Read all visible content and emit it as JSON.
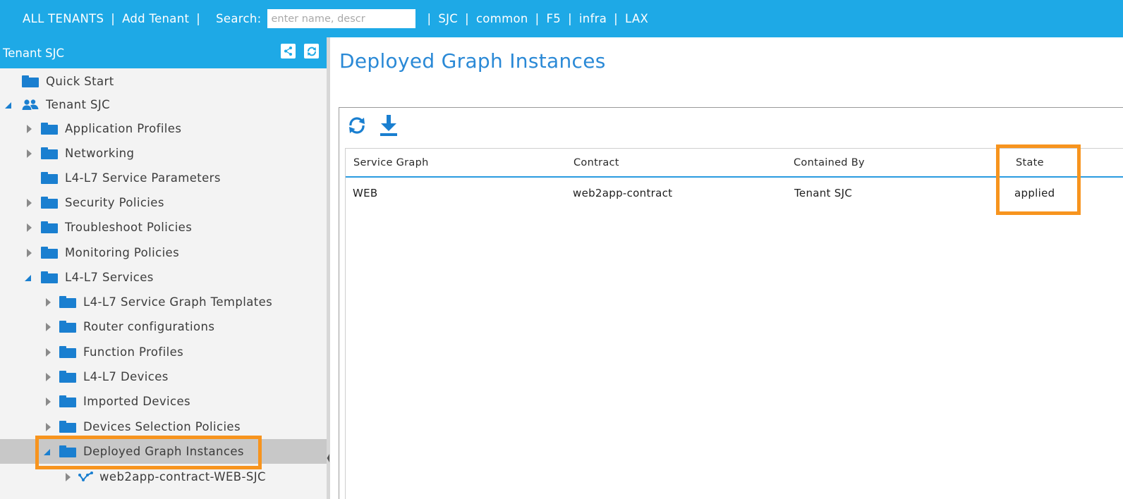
{
  "topbar": {
    "all_tenants": "ALL TENANTS",
    "add_tenant": "Add Tenant",
    "search_label": "Search:",
    "search_placeholder": "enter name, descr",
    "tenant_links": [
      "SJC",
      "common",
      "F5",
      "infra",
      "LAX"
    ]
  },
  "sidebar": {
    "title": "Tenant SJC",
    "tree": [
      {
        "label": "Quick Start",
        "level": 0,
        "toggle": "none",
        "icon": "folder-icon"
      },
      {
        "label": "Tenant SJC",
        "level": 0,
        "toggle": "expanded",
        "icon": "tenant-users-icon"
      },
      {
        "label": "Application Profiles",
        "level": 1,
        "toggle": "collapsed",
        "icon": "folder-icon"
      },
      {
        "label": "Networking",
        "level": 1,
        "toggle": "collapsed",
        "icon": "folder-icon"
      },
      {
        "label": "L4-L7 Service Parameters",
        "level": 1,
        "toggle": "none",
        "icon": "folder-icon"
      },
      {
        "label": "Security Policies",
        "level": 1,
        "toggle": "collapsed",
        "icon": "folder-icon"
      },
      {
        "label": "Troubleshoot Policies",
        "level": 1,
        "toggle": "collapsed",
        "icon": "folder-icon"
      },
      {
        "label": "Monitoring Policies",
        "level": 1,
        "toggle": "collapsed",
        "icon": "folder-icon"
      },
      {
        "label": "L4-L7 Services",
        "level": 1,
        "toggle": "expanded",
        "icon": "folder-icon"
      },
      {
        "label": "L4-L7 Service Graph Templates",
        "level": 2,
        "toggle": "collapsed",
        "icon": "folder-icon"
      },
      {
        "label": "Router configurations",
        "level": 2,
        "toggle": "collapsed",
        "icon": "folder-icon"
      },
      {
        "label": "Function Profiles",
        "level": 2,
        "toggle": "collapsed",
        "icon": "folder-icon"
      },
      {
        "label": "L4-L7 Devices",
        "level": 2,
        "toggle": "collapsed",
        "icon": "folder-icon"
      },
      {
        "label": "Imported Devices",
        "level": 2,
        "toggle": "collapsed",
        "icon": "folder-icon"
      },
      {
        "label": "Devices Selection Policies",
        "level": 2,
        "toggle": "collapsed",
        "icon": "folder-icon"
      },
      {
        "label": "Deployed Graph Instances",
        "level": 2,
        "toggle": "expanded",
        "icon": "folder-icon",
        "selected": true
      },
      {
        "label": "web2app-contract-WEB-SJC",
        "level": 3,
        "toggle": "collapsed",
        "icon": "graph-instance-icon"
      }
    ]
  },
  "main": {
    "title": "Deployed Graph Instances",
    "toolbar": {
      "refresh_icon": "refresh-icon",
      "download_icon": "download-icon"
    },
    "table": {
      "columns": [
        "Service Graph",
        "Contract",
        "Contained By",
        "State"
      ],
      "rows": [
        [
          "WEB",
          "web2app-contract",
          "Tenant SJC",
          "applied"
        ]
      ]
    }
  },
  "colors": {
    "header_blue": "#1ea9e6",
    "title_blue": "#2a89d6",
    "folder_blue": "#1a7fd0",
    "highlight_orange": "#f7941e",
    "selected_row": "#c8c8c8"
  }
}
